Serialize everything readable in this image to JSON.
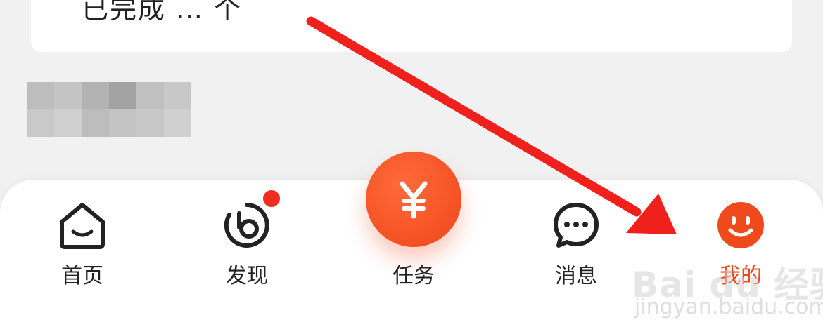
{
  "top_card": {
    "partial_text": "已完成 … 个"
  },
  "tabbar": {
    "tabs": [
      {
        "id": "home",
        "label": "首页"
      },
      {
        "id": "discover",
        "label": "发现",
        "has_badge": true
      },
      {
        "id": "task",
        "label": "任务",
        "center_symbol": "¥"
      },
      {
        "id": "messages",
        "label": "消息"
      },
      {
        "id": "mine",
        "label": "我的",
        "active": true
      }
    ],
    "active_color": "#f04a1c",
    "badge_color": "#f02d1e"
  },
  "icons": {
    "home": "home-icon",
    "discover": "discover-icon",
    "task": "yen-icon",
    "messages": "chat-bubble-icon",
    "mine": "smiley-icon"
  },
  "annotation": {
    "arrow_color": "#f0211d",
    "points_to": "我的"
  },
  "watermark": {
    "brand": "Bai du 经验",
    "url": "jingyan.baidu.com"
  }
}
